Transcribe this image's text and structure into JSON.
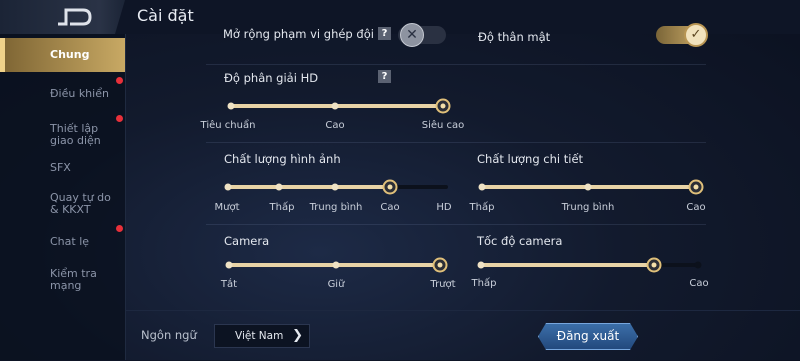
{
  "header": {
    "title": "Cài đặt"
  },
  "sidebar": {
    "items": [
      {
        "label": "Chung",
        "active": true,
        "badge": false
      },
      {
        "label": "Điều khiển",
        "active": false,
        "badge": true
      },
      {
        "label": "Thiết lập giao diện",
        "active": false,
        "badge": true
      },
      {
        "label": "SFX",
        "active": false,
        "badge": false
      },
      {
        "label": "Quay tự do & KKXT",
        "active": false,
        "badge": false
      },
      {
        "label": "Chat lẹ",
        "active": false,
        "badge": true
      },
      {
        "label": "Kiểm tra mạng",
        "active": false,
        "badge": false
      }
    ]
  },
  "settings": {
    "expand_match": {
      "label": "Mở rộng phạm vi ghép đội",
      "help": "?",
      "enabled": false
    },
    "intimacy": {
      "label": "Độ thân mật",
      "enabled": true
    },
    "hd_resolution": {
      "label": "Độ phân giải HD",
      "help": "?",
      "options": [
        "Tiêu chuẩn",
        "Cao",
        "Siêu cao"
      ],
      "selected_index": 2
    },
    "image_quality": {
      "label": "Chất lượng hình ảnh",
      "options": [
        "Mượt",
        "Thấp",
        "Trung bình",
        "Cao",
        "HD"
      ],
      "selected_index": 3
    },
    "detail_quality": {
      "label": "Chất lượng chi tiết",
      "options": [
        "Thấp",
        "Trung bình",
        "Cao"
      ],
      "selected_index": 2
    },
    "camera": {
      "label": "Camera",
      "options": [
        "Tắt",
        "Giữ",
        "Trượt"
      ],
      "selected_index": 2
    },
    "camera_speed": {
      "label": "Tốc độ camera",
      "min_label": "Thấp",
      "max_label": "Cao",
      "value_fraction": 0.8
    }
  },
  "footer": {
    "language_label": "Ngôn ngữ",
    "language_value": "Việt Nam",
    "logout_label": "Đăng xuất"
  }
}
